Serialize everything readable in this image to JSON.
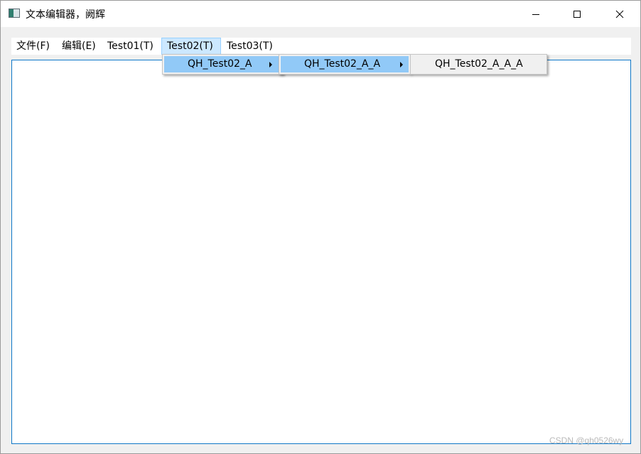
{
  "window": {
    "title": "文本编辑器，阙辉"
  },
  "menubar": {
    "items": [
      {
        "label": "文件(F)"
      },
      {
        "label": "编辑(E)"
      },
      {
        "label": "Test01(T)"
      },
      {
        "label": "Test02(T)"
      },
      {
        "label": "Test03(T)"
      }
    ]
  },
  "submenus": {
    "level1": {
      "label": "QH_Test02_A"
    },
    "level2": {
      "label": "QH_Test02_A_A"
    },
    "level3": {
      "label": "QH_Test02_A_A_A"
    }
  },
  "watermark": {
    "text": "CSDN @qh0526wy"
  },
  "colors": {
    "menu_active_bg": "#cce8ff",
    "popup_highlight": "#91c9f7",
    "editor_border": "#0f78c8"
  },
  "icons": {
    "app": "app-window-icon",
    "minimize": "minimize-icon",
    "maximize": "maximize-icon",
    "close": "close-icon",
    "submenu_arrow": "submenu-arrow-icon"
  }
}
